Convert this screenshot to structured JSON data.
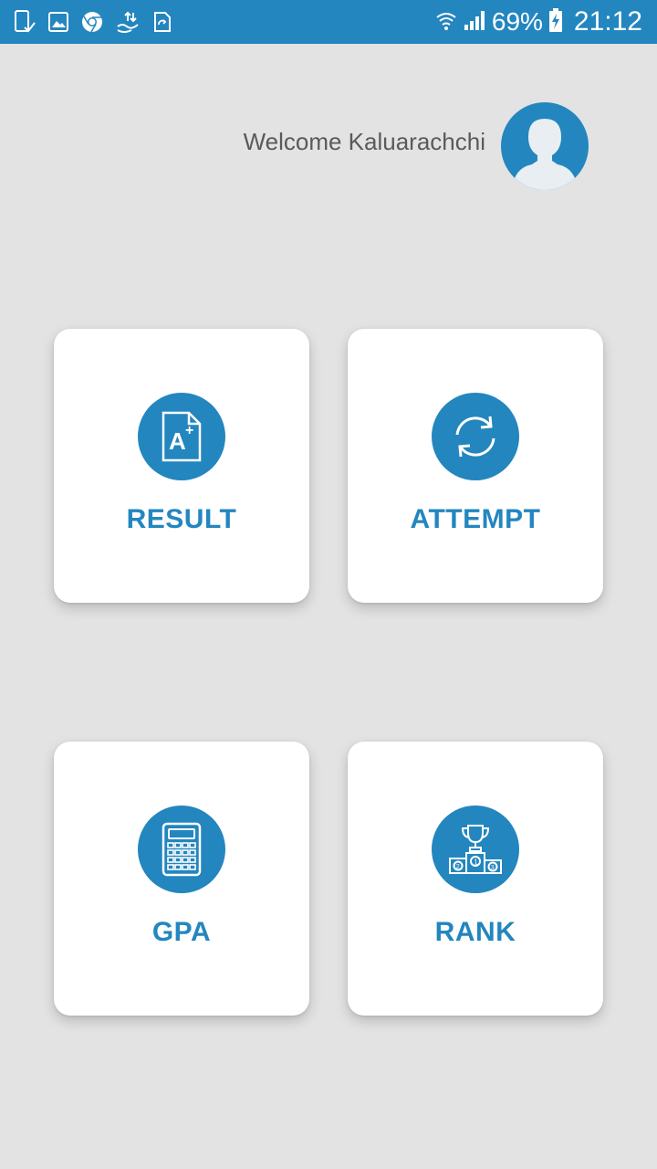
{
  "status_bar": {
    "battery_percent": "69%",
    "time": "21:12",
    "left_icons": [
      "device-check-icon",
      "gallery-icon",
      "chrome-icon",
      "data-transfer-icon",
      "file-sync-icon"
    ],
    "right_icons": [
      "wifi-icon",
      "signal-icon",
      "battery-charging-icon"
    ]
  },
  "header": {
    "welcome_text": "Welcome Kaluarachchi",
    "avatar_icon": "user-avatar-icon"
  },
  "cards": [
    {
      "label": "RESULT",
      "icon": "grade-document-icon"
    },
    {
      "label": "ATTEMPT",
      "icon": "refresh-icon"
    },
    {
      "label": "GPA",
      "icon": "calculator-icon"
    },
    {
      "label": "RANK",
      "icon": "trophy-podium-icon"
    }
  ],
  "colors": {
    "accent": "#2386bf",
    "background": "#e3e3e3",
    "card": "#ffffff",
    "welcome_text": "#5a5a5a"
  }
}
